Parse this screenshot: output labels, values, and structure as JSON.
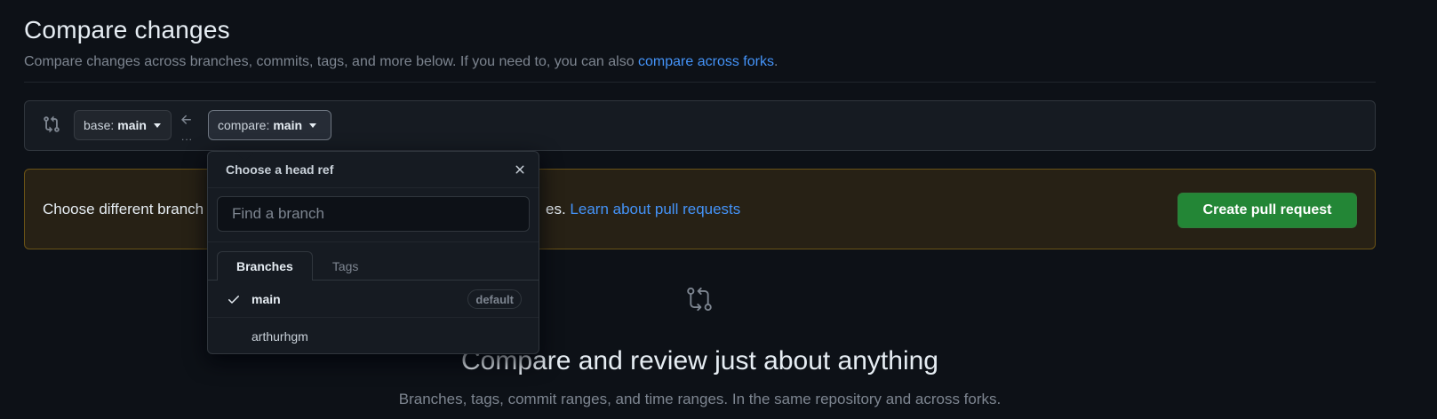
{
  "header": {
    "title": "Compare changes",
    "subtitle_prefix": "Compare changes across branches, commits, tags, and more below. If you need to, you can also ",
    "subtitle_link": "compare across forks",
    "subtitle_suffix": "."
  },
  "range": {
    "base_prefix": "base: ",
    "base_ref": "main",
    "compare_prefix": "compare: ",
    "compare_ref": "main",
    "arrow_dots": "..."
  },
  "flash": {
    "text_visible_start": "Choose different branch",
    "text_visible_end": "es.",
    "link": "Learn about pull requests",
    "create_button": "Create pull request"
  },
  "blankslate": {
    "title": "Compare and review just about anything",
    "subtitle": "Branches, tags, commit ranges, and time ranges. In the same repository and across forks."
  },
  "dropdown": {
    "title": "Choose a head ref",
    "filter_placeholder": "Find a branch",
    "tabs": [
      {
        "label": "Branches",
        "selected": true
      },
      {
        "label": "Tags",
        "selected": false
      }
    ],
    "items": [
      {
        "label": "main",
        "selected": true,
        "badge": "default"
      },
      {
        "label": "arthurhgm",
        "selected": false,
        "badge": ""
      }
    ]
  },
  "colors": {
    "background": "#0d1117",
    "link": "#4493f8",
    "create_button": "#238636",
    "flash_border": "#6b5316"
  },
  "icons": [
    "git-compare-icon",
    "arrow-left-icon",
    "close-icon",
    "check-icon"
  ]
}
